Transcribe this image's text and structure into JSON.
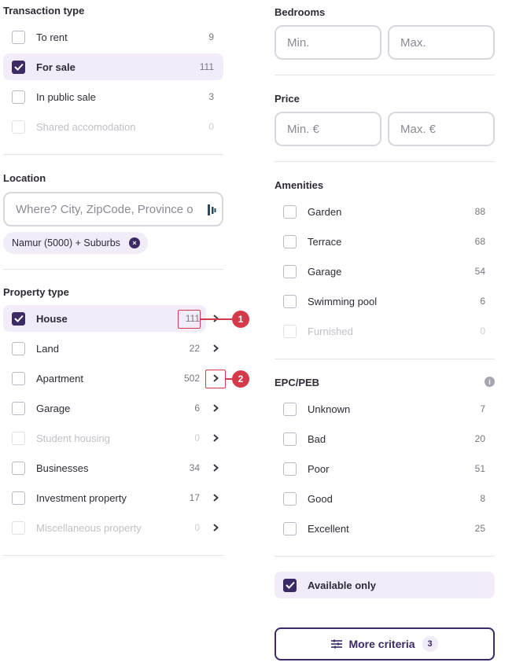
{
  "transaction": {
    "title": "Transaction type",
    "items": [
      {
        "label": "To rent",
        "count": "9",
        "checked": false,
        "disabled": false
      },
      {
        "label": "For sale",
        "count": "111",
        "checked": true,
        "disabled": false
      },
      {
        "label": "In public sale",
        "count": "3",
        "checked": false,
        "disabled": false
      },
      {
        "label": "Shared accomodation",
        "count": "0",
        "checked": false,
        "disabled": true
      }
    ]
  },
  "location": {
    "title": "Location",
    "placeholder": "Where? City, ZipCode, Province o",
    "chip": "Namur (5000) + Suburbs",
    "chip_remove": "×"
  },
  "property": {
    "title": "Property type",
    "items": [
      {
        "label": "House",
        "count": "111",
        "checked": true,
        "disabled": false
      },
      {
        "label": "Land",
        "count": "22",
        "checked": false,
        "disabled": false
      },
      {
        "label": "Apartment",
        "count": "502",
        "checked": false,
        "disabled": false
      },
      {
        "label": "Garage",
        "count": "6",
        "checked": false,
        "disabled": false
      },
      {
        "label": "Student housing",
        "count": "0",
        "checked": false,
        "disabled": true
      },
      {
        "label": "Businesses",
        "count": "34",
        "checked": false,
        "disabled": false
      },
      {
        "label": "Investment property",
        "count": "17",
        "checked": false,
        "disabled": false
      },
      {
        "label": "Miscellaneous property",
        "count": "0",
        "checked": false,
        "disabled": true
      }
    ]
  },
  "annotations": {
    "one": "1",
    "two": "2"
  },
  "bedrooms": {
    "title": "Bedrooms",
    "min": "Min.",
    "max": "Max."
  },
  "price": {
    "title": "Price",
    "min": "Min. €",
    "max": "Max. €"
  },
  "amenities": {
    "title": "Amenities",
    "items": [
      {
        "label": "Garden",
        "count": "88",
        "disabled": false
      },
      {
        "label": "Terrace",
        "count": "68",
        "disabled": false
      },
      {
        "label": "Garage",
        "count": "54",
        "disabled": false
      },
      {
        "label": "Swimming pool",
        "count": "6",
        "disabled": false
      },
      {
        "label": "Furnished",
        "count": "0",
        "disabled": true
      }
    ]
  },
  "epc": {
    "title": "EPC/PEB",
    "info": "i",
    "items": [
      {
        "label": "Unknown",
        "count": "7"
      },
      {
        "label": "Bad",
        "count": "20"
      },
      {
        "label": "Poor",
        "count": "51"
      },
      {
        "label": "Good",
        "count": "8"
      },
      {
        "label": "Excellent",
        "count": "25"
      }
    ]
  },
  "available": {
    "label": "Available only",
    "checked": true
  },
  "more": {
    "label": "More criteria",
    "badge": "3"
  },
  "colors": {
    "accent": "#3b2a66",
    "selected_bg": "#f2ecf8",
    "annotation": "#d33a4a"
  }
}
